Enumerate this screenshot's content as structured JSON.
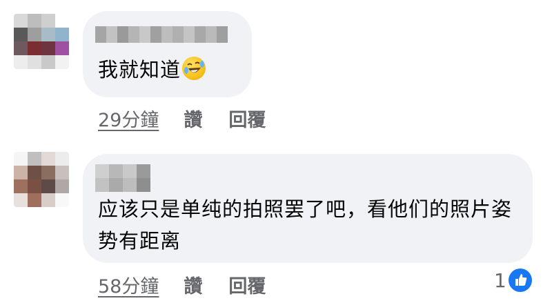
{
  "comments": [
    {
      "text": "我就知道",
      "emoji": "rolling-on-floor-laughing",
      "time": "29分鐘",
      "like_label": "讚",
      "reply_label": "回覆"
    },
    {
      "text": "应该只是单纯的拍照罢了吧，看他们的照片姿势有距离",
      "time": "58分鐘",
      "like_label": "讚",
      "reply_label": "回覆",
      "reaction_count": "1",
      "reaction_icon": "thumbs-up-icon"
    }
  ],
  "colors": {
    "bubble": "#f0f2f5",
    "meta_text": "#65676b",
    "like_blue": "#1877f2"
  }
}
